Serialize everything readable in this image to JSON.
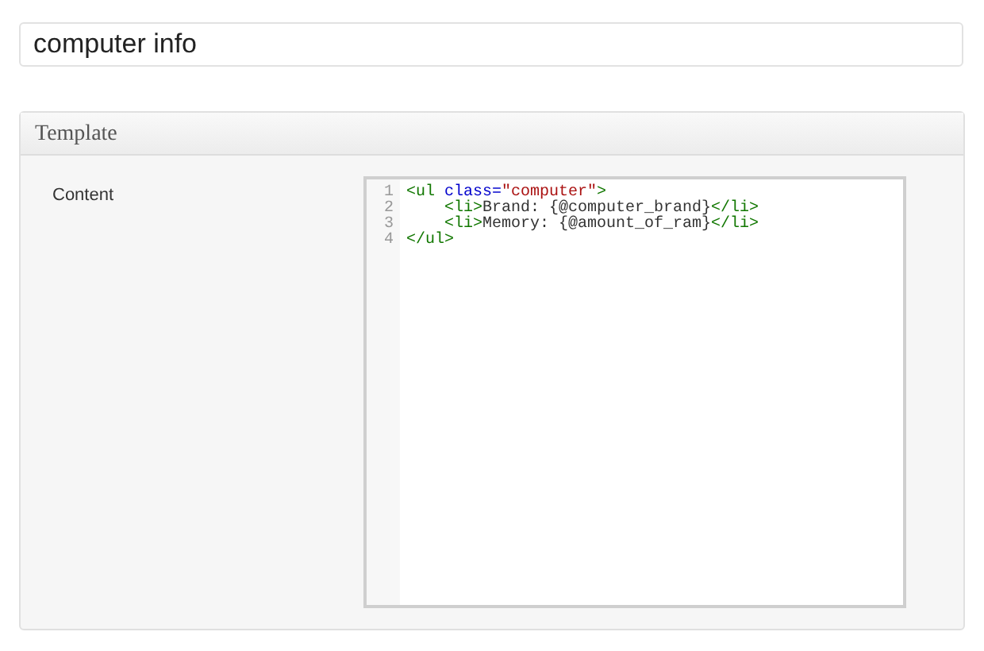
{
  "title_field": {
    "value": "computer info"
  },
  "panel": {
    "heading": "Template",
    "field_label": "Content",
    "code_lines": [
      {
        "number": "1",
        "indented": false,
        "tokens": [
          {
            "kind": "tag",
            "text": "<ul "
          },
          {
            "kind": "attr",
            "text": "class="
          },
          {
            "kind": "string",
            "text": "\"computer\""
          },
          {
            "kind": "tag",
            "text": ">"
          }
        ]
      },
      {
        "number": "2",
        "indented": true,
        "tokens": [
          {
            "kind": "tag",
            "text": "<li>"
          },
          {
            "kind": "text",
            "text": "Brand: {@computer_brand}"
          },
          {
            "kind": "tag",
            "text": "</li>"
          }
        ]
      },
      {
        "number": "3",
        "indented": true,
        "tokens": [
          {
            "kind": "tag",
            "text": "<li>"
          },
          {
            "kind": "text",
            "text": "Memory: {@amount_of_ram}"
          },
          {
            "kind": "tag",
            "text": "</li>"
          }
        ]
      },
      {
        "number": "4",
        "indented": false,
        "tokens": [
          {
            "kind": "tag",
            "text": "</ul>"
          }
        ]
      }
    ]
  }
}
